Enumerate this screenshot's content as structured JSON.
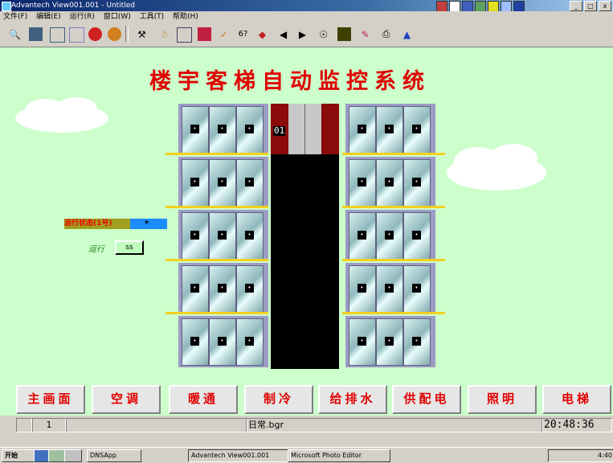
{
  "window": {
    "title": "Advantech View001.001 - Untitled",
    "min_label": "_",
    "max_label": "□",
    "close_label": "x"
  },
  "menu": [
    "文件(F)",
    "编辑(E)",
    "运行(R)",
    "窗口(W)",
    "工具(T)",
    "帮助(H)"
  ],
  "toolbar_icons": [
    "search-icon",
    "save-icon",
    "image-icon",
    "chart-icon",
    "record-icon",
    "stop-icon",
    "tool-icon",
    "folder-icon",
    "edit-icon",
    "chart2-icon",
    "check-icon",
    "tag-icon",
    "color-icon",
    "back-icon",
    "forward-icon",
    "zoom-icon",
    "barcode-icon",
    "brush-icon",
    "print-icon",
    "info-icon"
  ],
  "title": "楼宇客梯自动监控系统",
  "status_panel": {
    "label": "运行状态(1号)",
    "value": "*",
    "run_label": "运行",
    "run_value": "ss"
  },
  "elevator": {
    "floor_display": "01"
  },
  "buttons": [
    "主画面",
    "空调",
    "暖通",
    "制冷",
    "给排水",
    "供配电",
    "照明",
    "电梯"
  ],
  "statusbar": {
    "cell1": "",
    "page": "1",
    "cell3": "",
    "file": "日常.bgr",
    "time": "20:48:36"
  },
  "taskbar": {
    "start": "开始",
    "tasks": [
      "DNSApp",
      "Advantech View001.001",
      "Microsoft Photo Editor"
    ],
    "tray_time": "4:40"
  },
  "colors": {
    "accent": "#e00000",
    "background": "#ccffcc",
    "shaft": "#000000",
    "door": "#8fb8bc"
  }
}
